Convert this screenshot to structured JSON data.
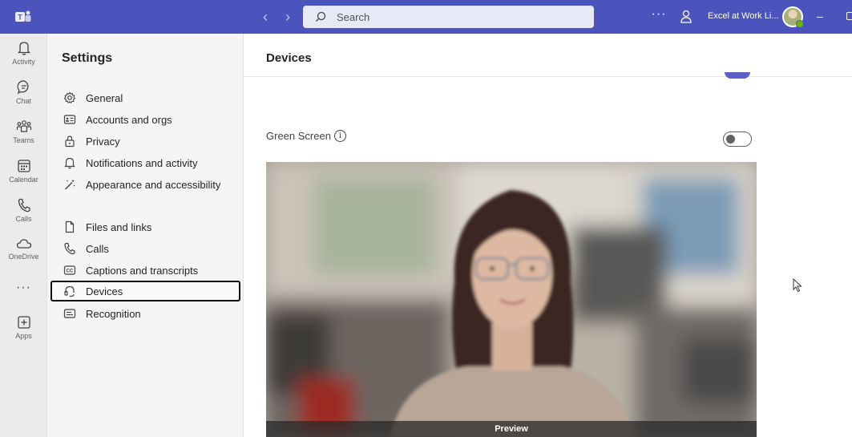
{
  "titlebar": {
    "search_placeholder": "Search",
    "org_name": "Excel at Work Li...",
    "more_label": "···",
    "minimize_label": "–"
  },
  "rail": {
    "items": [
      {
        "label": "Activity",
        "icon": "bell-icon"
      },
      {
        "label": "Chat",
        "icon": "chat-icon"
      },
      {
        "label": "Teams",
        "icon": "teams-icon"
      },
      {
        "label": "Calendar",
        "icon": "calendar-icon"
      },
      {
        "label": "Calls",
        "icon": "phone-icon"
      },
      {
        "label": "OneDrive",
        "icon": "cloud-icon"
      }
    ],
    "more_label": "···",
    "apps_label": "Apps"
  },
  "settings": {
    "title": "Settings",
    "items": [
      {
        "label": "General",
        "icon": "gear-icon"
      },
      {
        "label": "Accounts and orgs",
        "icon": "id-card-icon"
      },
      {
        "label": "Privacy",
        "icon": "lock-icon"
      },
      {
        "label": "Notifications and activity",
        "icon": "bell-icon"
      },
      {
        "label": "Appearance and accessibility",
        "icon": "wand-icon"
      },
      {
        "label": "Files and links",
        "icon": "file-icon"
      },
      {
        "label": "Calls",
        "icon": "phone-icon"
      },
      {
        "label": "Captions and transcripts",
        "icon": "cc-icon"
      },
      {
        "label": "Devices",
        "icon": "headset-icon",
        "selected": true
      },
      {
        "label": "Recognition",
        "icon": "recognition-icon"
      }
    ]
  },
  "main": {
    "title": "Devices",
    "green_screen_label": "Green Screen",
    "info_glyph": "i",
    "green_screen_on": false,
    "preview_label": "Preview"
  },
  "colors": {
    "brand": "#4b53bc",
    "accent": "#5b5fc7"
  }
}
